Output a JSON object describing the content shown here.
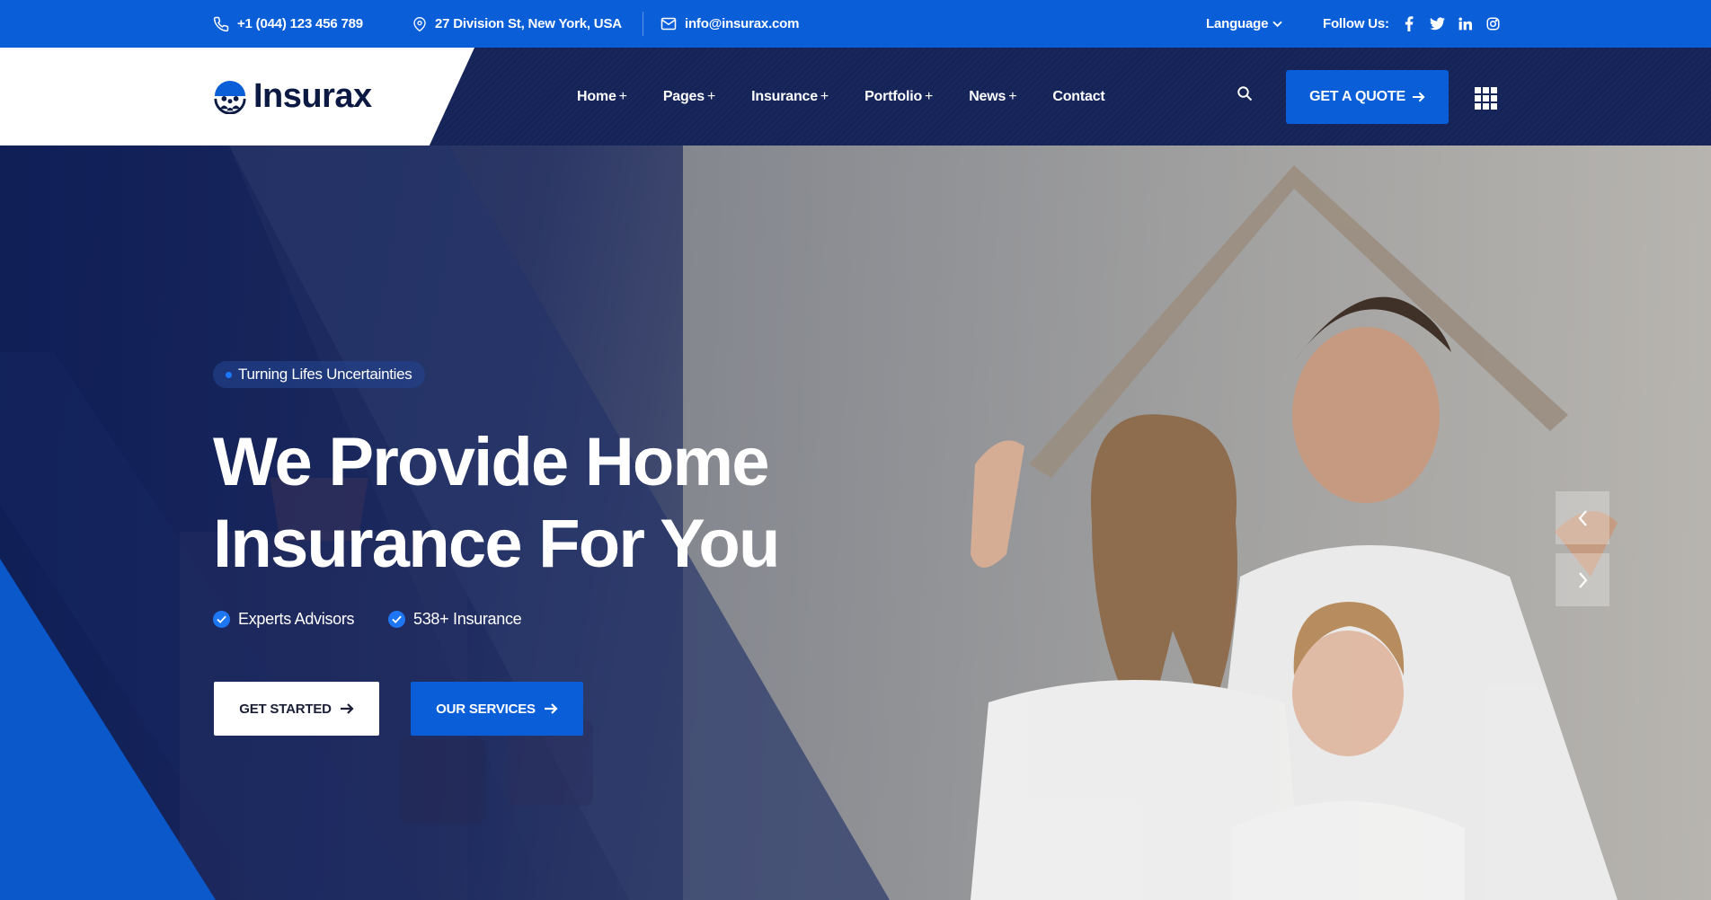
{
  "topbar": {
    "phone": "+1 (044) 123 456 789",
    "address": "27 Division St, New York, USA",
    "email": "info@insurax.com",
    "language_label": "Language",
    "follow_label": "Follow Us:",
    "social_icons": [
      "facebook-icon",
      "twitter-icon",
      "linkedin-icon",
      "instagram-icon"
    ]
  },
  "header": {
    "logo_text": "Insurax",
    "nav": [
      {
        "label": "Home",
        "suffix": "+"
      },
      {
        "label": "Pages",
        "suffix": "+"
      },
      {
        "label": "Insurance",
        "suffix": "+"
      },
      {
        "label": "Portfolio",
        "suffix": "+"
      },
      {
        "label": "News",
        "suffix": "+"
      },
      {
        "label": "Contact",
        "suffix": ""
      }
    ],
    "quote_button": "GET A QUOTE"
  },
  "hero": {
    "tagline": "Turning Lifes Uncertainties",
    "headline_line1": "We Provide Home",
    "headline_line2": "Insurance For You",
    "features": [
      "Experts Advisors",
      "538+ Insurance"
    ],
    "primary_button": "GET STARTED",
    "secondary_button": "OUR SERVICES"
  },
  "colors": {
    "brand_blue": "#0a5ed7",
    "navy": "#142255",
    "white": "#ffffff"
  }
}
